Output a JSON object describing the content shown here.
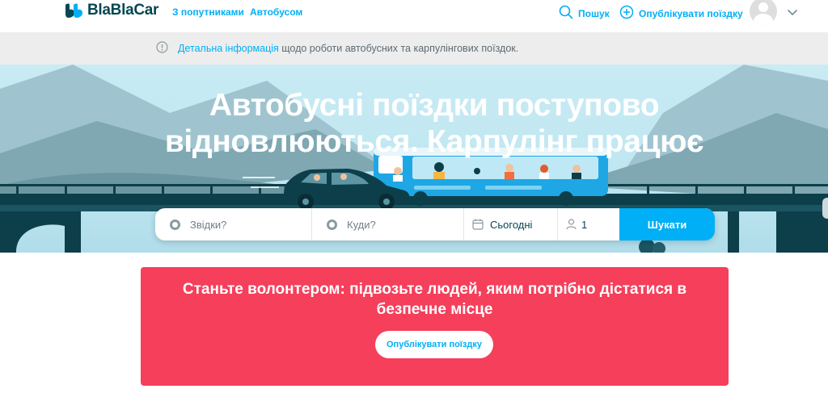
{
  "navbar": {
    "logo_text": "BlaBlaCar",
    "links": [
      "З попутниками",
      "Автобусом"
    ],
    "search_label": "Пошук",
    "publish_label": "Опублікувати поїздку"
  },
  "info_bar": {
    "link_text": "Детальна інформація",
    "rest_text": " щодо роботи автобусних та карпулінгових поїздок."
  },
  "hero": {
    "title_line1": "Автобусні поїздки поступово",
    "title_line2": "відновлюються. Карпулінг працює"
  },
  "search": {
    "from_placeholder": "Звідки?",
    "to_placeholder": "Куди?",
    "date_value": "Сьогодні",
    "passengers_value": "1",
    "button_label": "Шукати"
  },
  "promo": {
    "title": "Станьте волонтером: підвозьте людей, яким потрібно дістатися в безпечне місце",
    "button_label": "Опублікувати поїздку"
  },
  "colors": {
    "brand_blue": "#00aff5",
    "dark_teal": "#054752",
    "promo_red": "#f53f5b"
  },
  "icons": [
    "logo-icon",
    "search-icon",
    "plus-circle-icon",
    "avatar-icon",
    "chevron-down-icon",
    "info-icon",
    "location-dot-icon",
    "calendar-icon",
    "person-icon"
  ]
}
